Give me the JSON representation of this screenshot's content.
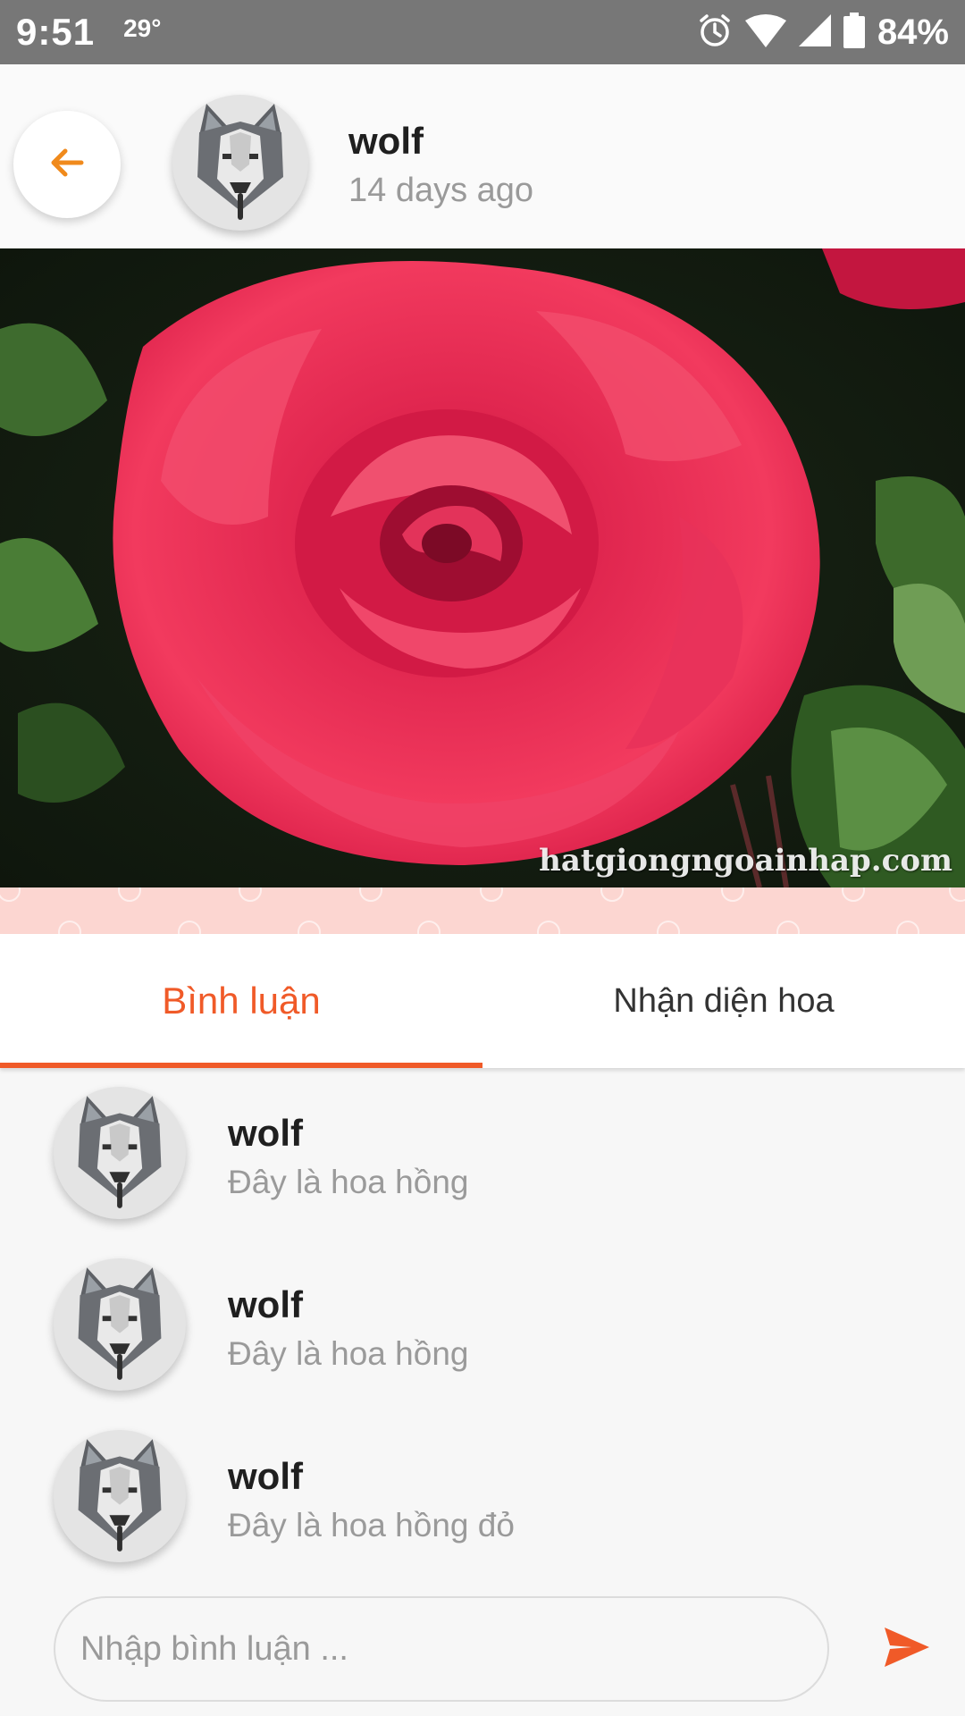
{
  "status_bar": {
    "time": "9:51",
    "temperature": "29°",
    "battery": "84%",
    "icons": [
      "alarm-icon",
      "wifi-icon",
      "signal-icon",
      "battery-icon"
    ]
  },
  "header": {
    "back_icon": "arrow-left-icon",
    "avatar_icon": "wolf-avatar",
    "name": "wolf",
    "time_ago": "14 days ago"
  },
  "photo": {
    "subject": "red rose",
    "watermark": "hatgiongngoainhap.com"
  },
  "tabs": [
    {
      "label": "Bình luận",
      "active": true
    },
    {
      "label": "Nhận diện hoa",
      "active": false
    }
  ],
  "comments": [
    {
      "name": "wolf",
      "text": "Đây là hoa hồng"
    },
    {
      "name": "wolf",
      "text": "Đây là hoa hồng"
    },
    {
      "name": "wolf",
      "text": "Đây là hoa hồng đỏ"
    }
  ],
  "comment_input": {
    "placeholder": "Nhập bình luận ...",
    "value": ""
  },
  "colors": {
    "accent": "#f05a28",
    "back_arrow": "#f08a1c",
    "status_bar": "#777777"
  }
}
